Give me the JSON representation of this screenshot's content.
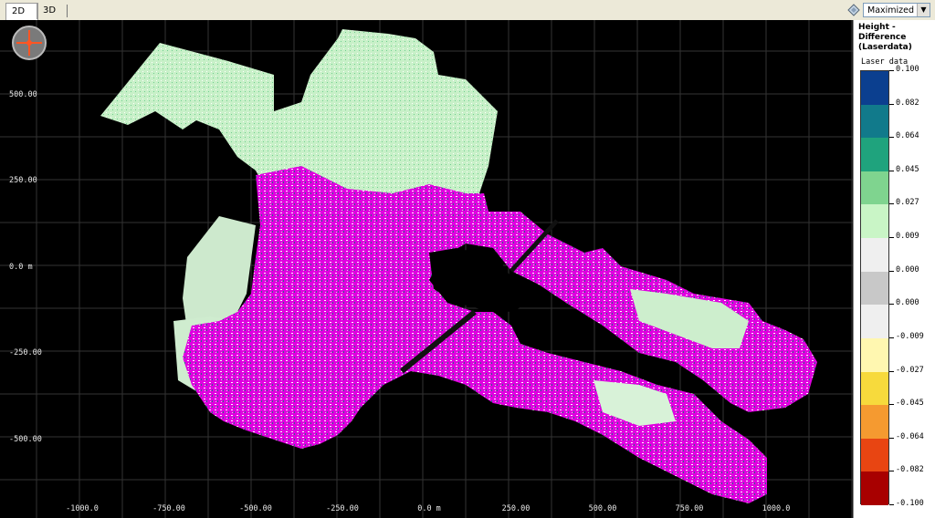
{
  "toolbar": {
    "tabs": [
      {
        "label": "2D",
        "active": true
      },
      {
        "label": "3D",
        "active": false
      }
    ],
    "view_mode": "Maximized",
    "view_icon": "diamond-view-icon"
  },
  "viewport": {
    "x_ticks": [
      "-1000.0",
      "-750.00",
      "-500.00",
      "-250.00",
      "0.0 m",
      "250.00",
      "500.00",
      "750.00",
      "1000.0"
    ],
    "y_ticks": [
      "500.00",
      "250.00",
      "0.0 m",
      "-250.00",
      "-500.00"
    ],
    "logo_icon": "app-logo-icon",
    "colors": {
      "background": "#000000",
      "grid": "#333333",
      "high_difference": "#e000e0",
      "low_difference": "#c8f0c8"
    }
  },
  "legend": {
    "title": "Height -\nDifference\n(Laserdata)",
    "subtitle": "Laser data",
    "entries": [
      {
        "label": "0.100",
        "color": "#0b3f8f"
      },
      {
        "label": "0.082",
        "color": "#117a8b"
      },
      {
        "label": "0.064",
        "color": "#1fa37d"
      },
      {
        "label": "0.045",
        "color": "#7fd48f"
      },
      {
        "label": "0.027",
        "color": "#c9f5c6"
      },
      {
        "label": "0.009",
        "color": "#efefef"
      },
      {
        "label": "0.000",
        "color": "#c8c8c8"
      },
      {
        "label": "0.000",
        "color": "#efefef"
      },
      {
        "label": "-0.009",
        "color": "#fff7b0"
      },
      {
        "label": "-0.027",
        "color": "#f7da3c"
      },
      {
        "label": "-0.045",
        "color": "#f59a30"
      },
      {
        "label": "-0.064",
        "color": "#e84512"
      },
      {
        "label": "-0.082",
        "color": "#a80000"
      },
      {
        "label": "-0.100",
        "color": ""
      }
    ]
  }
}
